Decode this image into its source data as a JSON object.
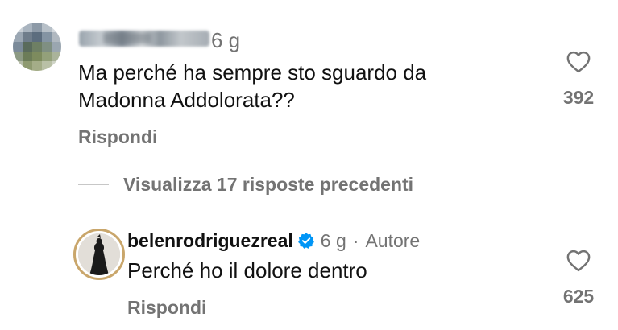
{
  "comments": [
    {
      "time": "6 g",
      "text_line1": "Ma perché ha sempre sto sguardo da",
      "text_line2": "Madonna Addolorata??",
      "reply_label": "Rispondi",
      "likes": "392",
      "like_icon": "heart-outline-icon",
      "avatar_icon": "pixelated-avatar"
    },
    {
      "username": "belenrodriguezreal",
      "verified_icon": "verified-badge-icon",
      "time": "6 g",
      "separator": "·",
      "author_label": "Autore",
      "text": "Perché ho il dolore dentro",
      "reply_label": "Rispondi",
      "likes": "625",
      "like_icon": "heart-outline-icon",
      "avatar_icon": "profile-avatar"
    }
  ],
  "thread": {
    "view_previous_replies": "Visualizza 17 risposte precedenti"
  },
  "colors": {
    "text": "#111111",
    "secondary": "#737373",
    "verified": "#0095f6",
    "background": "#ffffff"
  }
}
